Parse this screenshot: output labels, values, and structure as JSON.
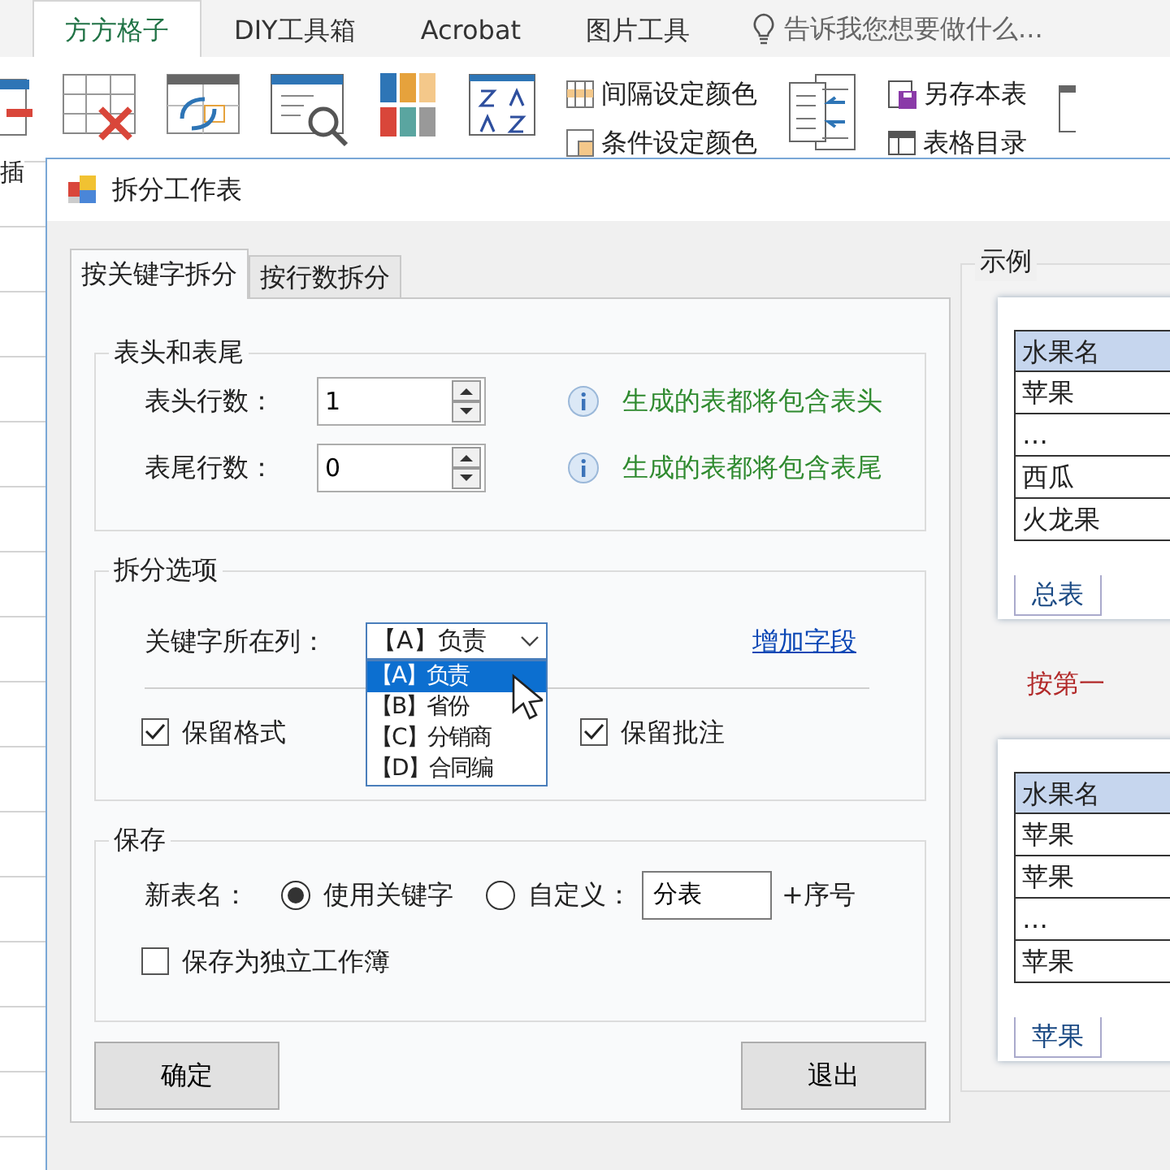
{
  "ribbon": {
    "tabs": [
      {
        "label": "方方格子",
        "selected": true
      },
      {
        "label": "DIY工具箱",
        "selected": false
      },
      {
        "label": "Acrobat",
        "selected": false
      },
      {
        "label": "图片工具",
        "selected": false
      }
    ],
    "tell_me": "告诉我您想要做什么...",
    "commands": [
      "间隔设定颜色",
      "条件设定颜色",
      "另存本表",
      "表格目录"
    ],
    "left_label": "插"
  },
  "dialog": {
    "title": "拆分工作表",
    "tabs": [
      {
        "label": "按关键字拆分",
        "selected": true
      },
      {
        "label": "按行数拆分",
        "selected": false
      }
    ],
    "header_footer": {
      "title": "表头和表尾",
      "rows": [
        {
          "label": "表头行数：",
          "value": "1",
          "hint": "生成的表都将包含表头"
        },
        {
          "label": "表尾行数：",
          "value": "0",
          "hint": "生成的表都将包含表尾"
        }
      ]
    },
    "split_options": {
      "title": "拆分选项",
      "key_column_label": "关键字所在列：",
      "key_column_value": "【A】负责",
      "add_field": "增加字段",
      "checkboxes": [
        {
          "label": "保留格式",
          "checked": true
        },
        {
          "label": "保留批注",
          "checked": true
        }
      ],
      "dropdown": [
        {
          "label": "【A】负责",
          "selected": true
        },
        {
          "label": "【B】省份",
          "selected": false
        },
        {
          "label": "【C】分销商",
          "selected": false
        },
        {
          "label": "【D】合同编",
          "selected": false
        }
      ]
    },
    "save": {
      "title": "保存",
      "name_label": "新表名：",
      "radios": [
        {
          "label": "使用关键字",
          "selected": true
        },
        {
          "label": "自定义：",
          "selected": false
        }
      ],
      "custom_name": "分表",
      "suffix": "+序号",
      "separate_workbook": {
        "label": "保存为独立工作簿",
        "checked": false
      }
    },
    "buttons": [
      "确定",
      "退出"
    ],
    "example": {
      "title": "示例",
      "sheets": [
        {
          "cells": [
            "水果名",
            "苹果",
            "…",
            "西瓜",
            "火龙果"
          ],
          "tab": "总表"
        },
        {
          "cells": [
            "水果名",
            "苹果",
            "苹果",
            "…",
            "苹果"
          ],
          "tab": "苹果"
        }
      ],
      "caption": "按第一"
    }
  }
}
